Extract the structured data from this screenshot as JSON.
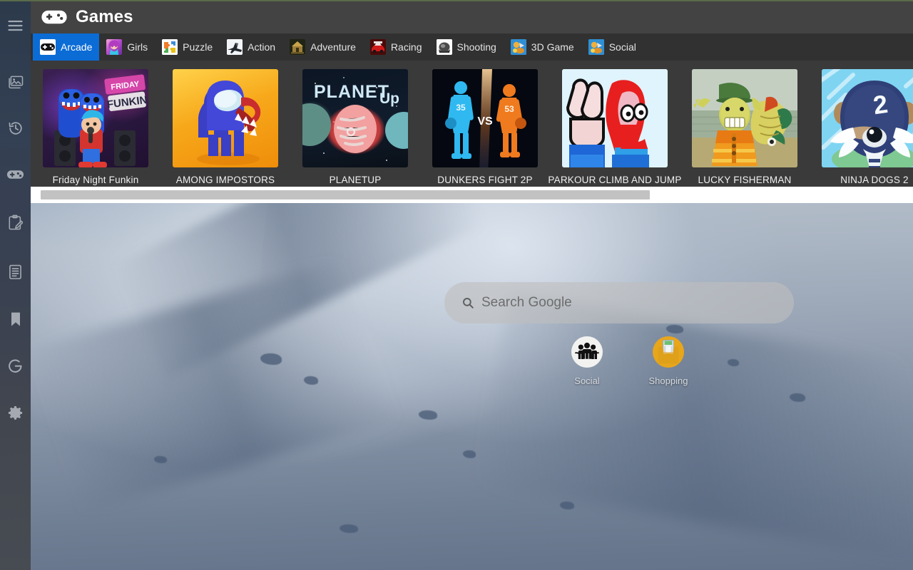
{
  "sidebar": {
    "items": [
      {
        "name": "hamburger-menu",
        "icon": "menu-icon"
      },
      {
        "name": "gallery",
        "icon": "images-icon"
      },
      {
        "name": "history",
        "icon": "history-clock-icon"
      },
      {
        "name": "games",
        "icon": "gamepad-icon"
      },
      {
        "name": "notes",
        "icon": "clipboard-pen-icon"
      },
      {
        "name": "list",
        "icon": "list-clipboard-icon"
      },
      {
        "name": "bookmarks",
        "icon": "bookmark-icon"
      },
      {
        "name": "google",
        "icon": "google-g-icon"
      },
      {
        "name": "settings",
        "icon": "gear-icon"
      }
    ]
  },
  "games_panel": {
    "title": "Games",
    "logo_icon": "gamepad-icon",
    "tabs": [
      {
        "label": "Arcade",
        "icon": "arcade-gamepad-icon",
        "active": true
      },
      {
        "label": "Girls",
        "icon": "girls-avatar-icon",
        "active": false
      },
      {
        "label": "Puzzle",
        "icon": "puzzle-pieces-icon",
        "active": false
      },
      {
        "label": "Action",
        "icon": "action-jet-icon",
        "active": false
      },
      {
        "label": "Adventure",
        "icon": "adventure-temple-icon",
        "active": false
      },
      {
        "label": "Racing",
        "icon": "racing-car-icon",
        "active": false
      },
      {
        "label": "Shooting",
        "icon": "shooting-target-icon",
        "active": false
      },
      {
        "label": "3D Game",
        "icon": "3d-game-icon",
        "active": false
      },
      {
        "label": "Social",
        "icon": "social-game-icon",
        "active": false
      }
    ],
    "cards": [
      {
        "title": "Friday Night Funkin",
        "art": "fnf"
      },
      {
        "title": "AMONG IMPOSTORS",
        "art": "among"
      },
      {
        "title": "PLANETUP",
        "art": "planet"
      },
      {
        "title": "DUNKERS FIGHT 2P",
        "art": "dunkers"
      },
      {
        "title": "PARKOUR CLIMB AND JUMP",
        "art": "parkour"
      },
      {
        "title": "LUCKY FISHERMAN",
        "art": "fisher"
      },
      {
        "title": "NINJA DOGS 2",
        "art": "ninja"
      }
    ],
    "scrollbar": {
      "thumb_percent": 69
    }
  },
  "desktop": {
    "search": {
      "placeholder": "Search Google",
      "value": "",
      "icon": "search-icon"
    },
    "shortcuts": [
      {
        "label": "Social",
        "icon": "people-group-icon"
      },
      {
        "label": "Shopping",
        "icon": "shopping-bag-icon"
      }
    ]
  },
  "colors": {
    "accent_tab_active": "#0b6cd6",
    "panel_bg": "#3a3a3a",
    "panel_header_bg": "#434343",
    "tabstrip_bg": "#313131",
    "sidebar_top": "#2c3a4c",
    "sidebar_bottom": "#474b52",
    "top_rule": "#5a6b4a",
    "scrollbar_track": "#ffffff",
    "scrollbar_thumb": "#c2c2c2"
  }
}
